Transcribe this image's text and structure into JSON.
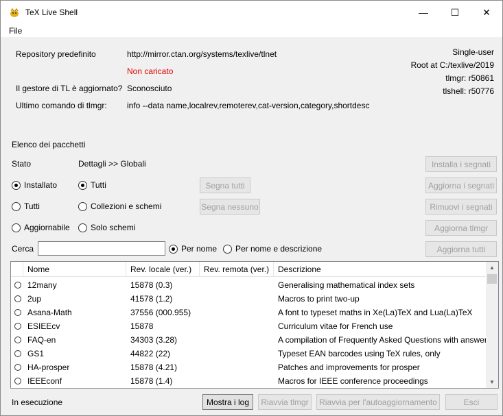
{
  "window": {
    "title": "TeX Live Shell",
    "controls": {
      "minimize": "—",
      "maximize": "☐",
      "close": "✕"
    }
  },
  "menu": {
    "file": "File"
  },
  "info": {
    "repo_label": "Repository predefinito",
    "repo_value": "http://mirror.ctan.org/systems/texlive/tlnet",
    "repo_status": "Non caricato",
    "updated_label": "Il gestore di TL è aggiornato?",
    "updated_value": "Sconosciuto",
    "last_cmd_label": "Ultimo comando di tlmgr:",
    "last_cmd_value": "info --data name,localrev,remoterev,cat-version,category,shortdesc",
    "mode": "Single-user",
    "root": "Root at C:/texlive/2019",
    "tlmgr_rev": "tlmgr: r50861",
    "tlshell_rev": "tlshell: r50776"
  },
  "packages": {
    "section_title": "Elenco dei pacchetti",
    "stato_label": "Stato",
    "dettagli_label": "Dettagli >> Globali",
    "stato_options": {
      "installed": "Installato",
      "all": "Tutti",
      "updatable": "Aggiornabile"
    },
    "detail_options": {
      "all": "Tutti",
      "collections": "Collezioni e schemi",
      "schemes": "Solo schemi"
    },
    "mark_all": "Segna tutti",
    "mark_none": "Segna nessuno",
    "actions": {
      "install_marked": "Installa i segnati",
      "update_marked": "Aggiorna i segnati",
      "remove_marked": "Rimuovi i segnati",
      "update_tlmgr": "Aggiorna tlmgr",
      "update_all": "Aggiorna tutti"
    },
    "search_label": "Cerca",
    "search_value": "",
    "search_by_name": "Per nome",
    "search_by_name_desc": "Per nome e descrizione"
  },
  "table": {
    "columns": [
      "Nome",
      "Rev. locale (ver.)",
      "Rev. remota (ver.)",
      "Descrizione"
    ],
    "rows": [
      {
        "name": "12many",
        "local": "15878 (0.3)",
        "remote": "",
        "desc": "Generalising mathematical index sets"
      },
      {
        "name": "2up",
        "local": "41578 (1.2)",
        "remote": "",
        "desc": "Macros to print two-up"
      },
      {
        "name": "Asana-Math",
        "local": "37556 (000.955)",
        "remote": "",
        "desc": "A font to typeset maths in Xe(La)TeX and Lua(La)TeX"
      },
      {
        "name": "ESIEEcv",
        "local": "15878",
        "remote": "",
        "desc": "Curriculum vitae for French use"
      },
      {
        "name": "FAQ-en",
        "local": "34303 (3.28)",
        "remote": "",
        "desc": "A compilation of Frequently Asked Questions with answers"
      },
      {
        "name": "GS1",
        "local": "44822 (22)",
        "remote": "",
        "desc": "Typeset EAN barcodes using TeX rules, only"
      },
      {
        "name": "HA-prosper",
        "local": "15878 (4.21)",
        "remote": "",
        "desc": "Patches and improvements for prosper"
      },
      {
        "name": "IEEEconf",
        "local": "15878 (1.4)",
        "remote": "",
        "desc": "Macros for IEEE conference proceedings"
      }
    ]
  },
  "footer": {
    "status": "In esecuzione",
    "show_log": "Mostra i log",
    "restart_tlmgr": "Riavvia tlmgr",
    "restart_self_update": "Riavvia per l'autoaggiornamento",
    "exit": "Esci"
  },
  "colors": {
    "error": "#e00000",
    "disabled_text": "#a0a0a0"
  }
}
